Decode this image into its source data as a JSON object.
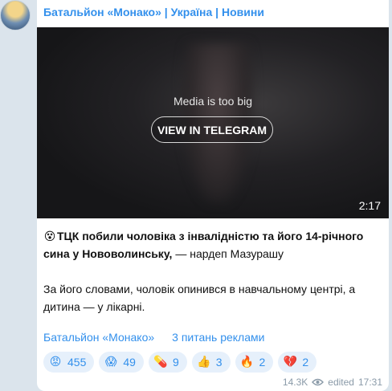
{
  "channel": {
    "name": "Батальйон «Монако» | Україна | Новини"
  },
  "media": {
    "notice": "Media is too big",
    "button_label": "VIEW IN TELEGRAM",
    "duration": "2:17"
  },
  "post": {
    "headline_emoji": "😵",
    "headline_bold": "ТЦК побили чоловіка з інвалідністю та його 14-річного сина у Нововолинську,",
    "headline_rest": " — нардеп Мазурашу",
    "body": "За його словами, чоловік опинився в навчальному центрі, а дитина — у лікарні."
  },
  "links": {
    "channel_link": "Батальйон «Монако»",
    "ads_link": "3 питань реклами"
  },
  "reactions": [
    {
      "icon": "angry-face-icon",
      "glyph": "😡",
      "count": "455"
    },
    {
      "icon": "screaming-face-icon",
      "glyph": "😱",
      "count": "49"
    },
    {
      "icon": "pill-icon",
      "glyph": "💊",
      "count": "9"
    },
    {
      "icon": "thumbs-up-icon",
      "glyph": "👍",
      "count": "3"
    },
    {
      "icon": "fire-icon",
      "glyph": "🔥",
      "count": "2"
    },
    {
      "icon": "broken-heart-icon",
      "glyph": "💔",
      "count": "2"
    }
  ],
  "meta": {
    "views": "14.3K",
    "edited_label": "edited",
    "time": "17:31"
  },
  "colors": {
    "accent": "#3390ec",
    "background": "#dbe4ec",
    "reaction_bg": "#e6f0fb"
  }
}
